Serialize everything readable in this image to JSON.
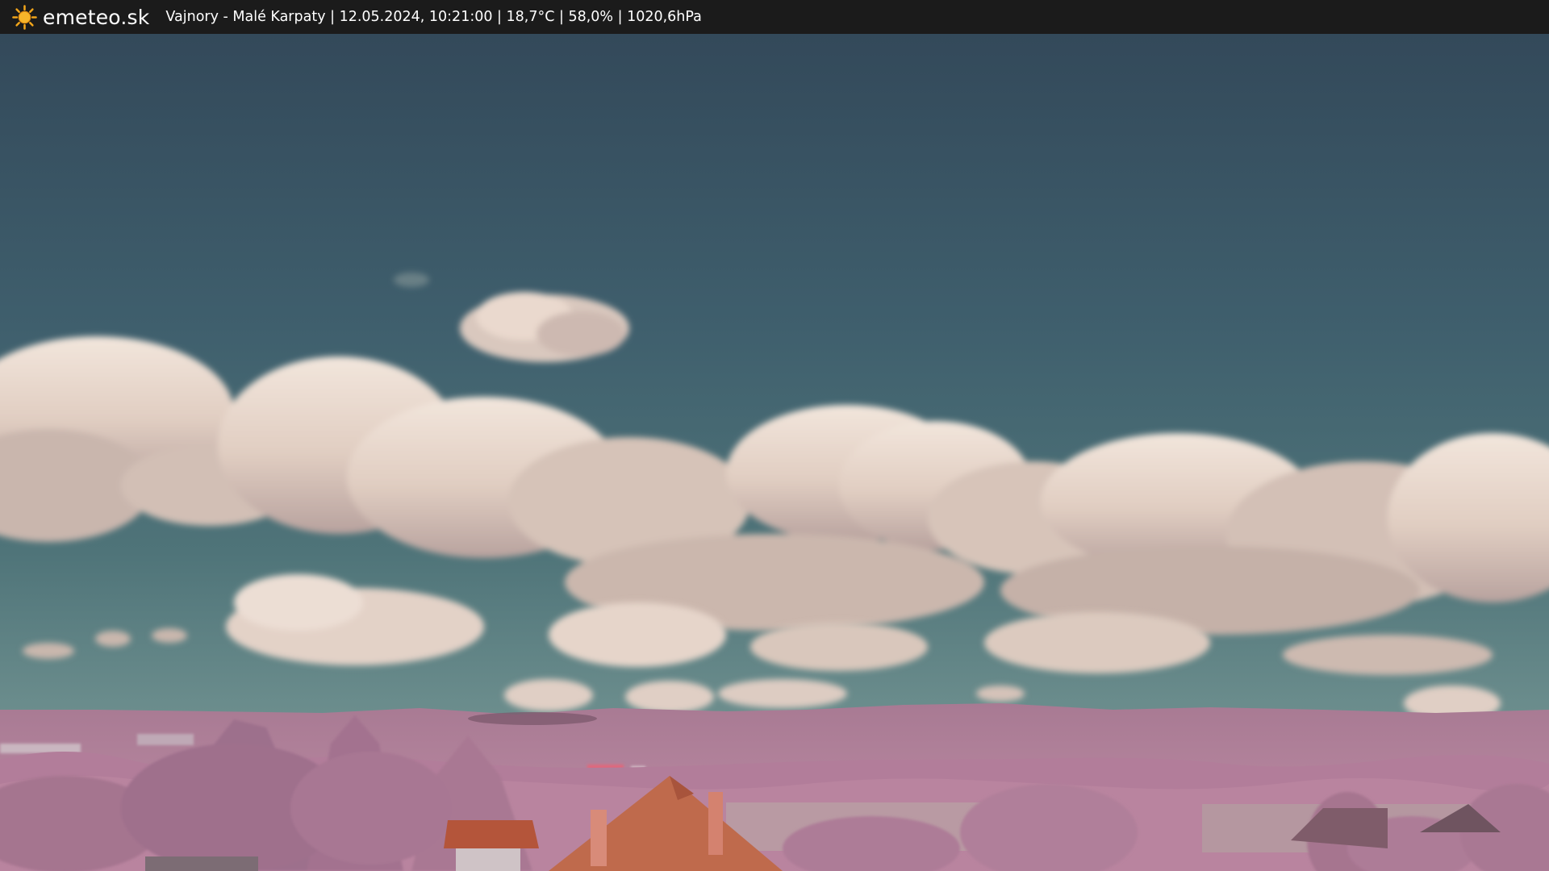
{
  "header": {
    "brand": "emeteo.sk",
    "logo_icon": "sun-icon",
    "status_line": "Vajnory - Malé Karpaty | 12.05.2024, 10:21:00 | 18,7°C | 58,0% | 1020,6hPa"
  },
  "colors": {
    "bar": "#1b1b1b",
    "sun": "#f2a51a",
    "sky_top": "#344e5c",
    "sky_horizon": "#5b7f82",
    "cloud": "#e3d2c7",
    "hills": "#a4738f",
    "foliage": "#b07a98",
    "roof": "#b5543a"
  }
}
